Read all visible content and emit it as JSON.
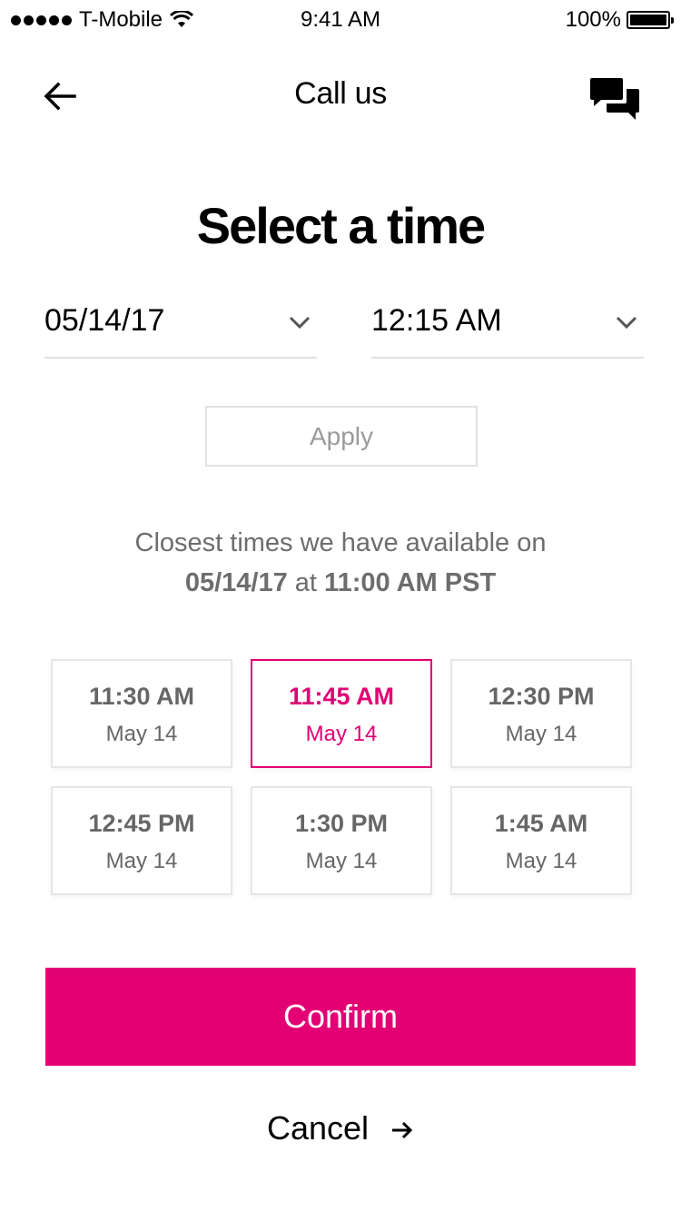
{
  "status_bar": {
    "carrier": "T-Mobile",
    "time": "9:41 AM",
    "battery": "100%"
  },
  "nav": {
    "title": "Call us",
    "back_icon": "arrow-left-icon",
    "chat_icon": "chat-bubbles-icon"
  },
  "page": {
    "heading": "Select a time"
  },
  "date_select": {
    "value": "05/14/17"
  },
  "time_select": {
    "value": "12:15 AM"
  },
  "apply_label": "Apply",
  "closest": {
    "line1": "Closest times we have available on",
    "date": "05/14/17",
    "at": "at",
    "time": "11:00 AM PST"
  },
  "slots": [
    {
      "time": "11:30 AM",
      "date": "May 14",
      "selected": false
    },
    {
      "time": "11:45 AM",
      "date": "May 14",
      "selected": true
    },
    {
      "time": "12:30 PM",
      "date": "May 14",
      "selected": false
    },
    {
      "time": "12:45 PM",
      "date": "May 14",
      "selected": false
    },
    {
      "time": "1:30 PM",
      "date": "May 14",
      "selected": false
    },
    {
      "time": "1:45 AM",
      "date": "May 14",
      "selected": false
    }
  ],
  "confirm_label": "Confirm",
  "cancel_label": "Cancel",
  "colors": {
    "accent": "#e20074",
    "muted_text": "#6d6d6d",
    "border": "#e6e6e6"
  }
}
